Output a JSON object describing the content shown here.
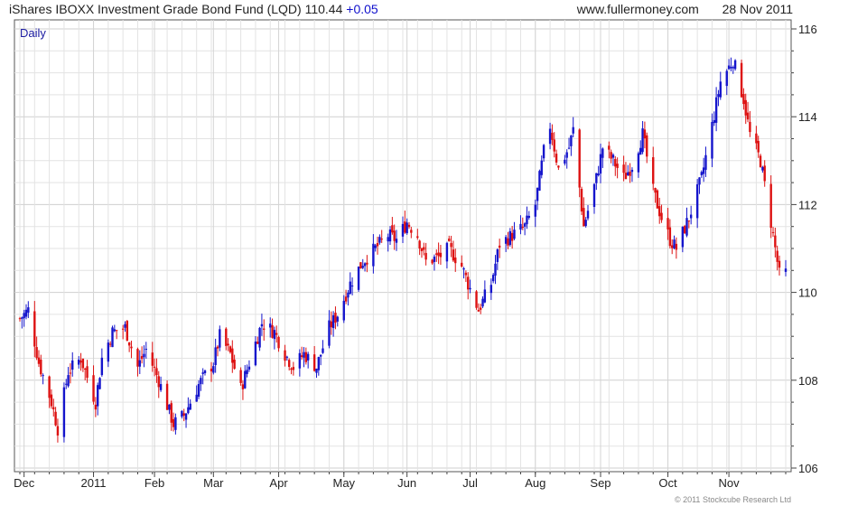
{
  "header": {
    "title": "iShares IBOXX Investment Grade Bond Fund (LQD)",
    "last": "110.44",
    "change": "+0.05",
    "website": "www.fullermoney.com",
    "date": "28 Nov 2011"
  },
  "footer": {
    "copyright": "© 2011 Stockcube Research Ltd"
  },
  "chart_data": {
    "type": "candlestick",
    "period_label": "Daily",
    "x_range": [
      "2010-11-29",
      "2011-11-28"
    ],
    "ylim": [
      106,
      116
    ],
    "y_ticks": [
      106,
      108,
      110,
      112,
      114,
      116
    ],
    "x_ticks": [
      {
        "label": "Dec",
        "date": "2010-12-01"
      },
      {
        "label": "2011",
        "date": "2011-01-03"
      },
      {
        "label": "Feb",
        "date": "2011-02-01"
      },
      {
        "label": "Mar",
        "date": "2011-03-01"
      },
      {
        "label": "Apr",
        "date": "2011-04-01"
      },
      {
        "label": "May",
        "date": "2011-05-02"
      },
      {
        "label": "Jun",
        "date": "2011-06-01"
      },
      {
        "label": "Jul",
        "date": "2011-07-01"
      },
      {
        "label": "Aug",
        "date": "2011-08-01"
      },
      {
        "label": "Sep",
        "date": "2011-09-01"
      },
      {
        "label": "Oct",
        "date": "2011-10-03"
      },
      {
        "label": "Nov",
        "date": "2011-11-01"
      }
    ],
    "grid": true,
    "axis_side": "right",
    "colors": {
      "up": "#1515cc",
      "down": "#dd1111",
      "grid": "#e3e3e3",
      "axis": "#444444",
      "label": "#1a1aa0"
    },
    "series_path": [
      [
        "2010-11-29",
        109.4
      ],
      [
        "2010-12-03",
        109.6
      ],
      [
        "2010-12-08",
        108.4
      ],
      [
        "2010-12-14",
        107.5
      ],
      [
        "2010-12-17",
        106.9
      ],
      [
        "2010-12-22",
        108.2
      ],
      [
        "2010-12-28",
        108.5
      ],
      [
        "2011-01-04",
        107.5
      ],
      [
        "2011-01-07",
        108.5
      ],
      [
        "2011-01-12",
        109.1
      ],
      [
        "2011-01-18",
        109.2
      ],
      [
        "2011-01-24",
        108.3
      ],
      [
        "2011-01-28",
        108.7
      ],
      [
        "2011-02-03",
        108.0
      ],
      [
        "2011-02-10",
        107.0
      ],
      [
        "2011-02-15",
        107.2
      ],
      [
        "2011-02-22",
        107.9
      ],
      [
        "2011-03-01",
        108.4
      ],
      [
        "2011-03-04",
        109.0
      ],
      [
        "2011-03-09",
        108.6
      ],
      [
        "2011-03-14",
        107.8
      ],
      [
        "2011-03-18",
        108.4
      ],
      [
        "2011-03-24",
        109.3
      ],
      [
        "2011-03-30",
        109.1
      ],
      [
        "2011-04-04",
        108.6
      ],
      [
        "2011-04-08",
        108.3
      ],
      [
        "2011-04-13",
        108.6
      ],
      [
        "2011-04-19",
        108.3
      ],
      [
        "2011-04-25",
        109.2
      ],
      [
        "2011-04-29",
        109.5
      ],
      [
        "2011-05-05",
        110.2
      ],
      [
        "2011-05-11",
        110.7
      ],
      [
        "2011-05-17",
        111.0
      ],
      [
        "2011-05-23",
        111.3
      ],
      [
        "2011-05-27",
        111.2
      ],
      [
        "2011-06-01",
        111.6
      ],
      [
        "2011-06-06",
        111.3
      ],
      [
        "2011-06-10",
        110.7
      ],
      [
        "2011-06-16",
        110.8
      ],
      [
        "2011-06-21",
        111.0
      ],
      [
        "2011-06-27",
        110.6
      ],
      [
        "2011-06-30",
        110.2
      ],
      [
        "2011-07-05",
        109.6
      ],
      [
        "2011-07-11",
        110.2
      ],
      [
        "2011-07-15",
        111.1
      ],
      [
        "2011-07-21",
        111.3
      ],
      [
        "2011-07-27",
        111.5
      ],
      [
        "2011-08-01",
        112.0
      ],
      [
        "2011-08-05",
        113.2
      ],
      [
        "2011-08-08",
        113.8
      ],
      [
        "2011-08-12",
        112.8
      ],
      [
        "2011-08-17",
        113.3
      ],
      [
        "2011-08-19",
        113.7
      ],
      [
        "2011-08-24",
        111.5
      ],
      [
        "2011-08-30",
        112.6
      ],
      [
        "2011-09-02",
        113.3
      ],
      [
        "2011-09-07",
        113.0
      ],
      [
        "2011-09-12",
        112.6
      ],
      [
        "2011-09-16",
        112.9
      ],
      [
        "2011-09-21",
        113.6
      ],
      [
        "2011-09-26",
        112.3
      ],
      [
        "2011-09-30",
        111.7
      ],
      [
        "2011-10-04",
        111.2
      ],
      [
        "2011-10-07",
        111.0
      ],
      [
        "2011-10-13",
        111.7
      ],
      [
        "2011-10-19",
        112.6
      ],
      [
        "2011-10-24",
        113.8
      ],
      [
        "2011-10-28",
        114.8
      ],
      [
        "2011-11-03",
        115.3
      ],
      [
        "2011-11-08",
        114.4
      ],
      [
        "2011-11-11",
        113.6
      ],
      [
        "2011-11-16",
        113.0
      ],
      [
        "2011-11-21",
        111.6
      ],
      [
        "2011-11-25",
        110.4
      ],
      [
        "2011-11-28",
        110.44
      ]
    ]
  }
}
